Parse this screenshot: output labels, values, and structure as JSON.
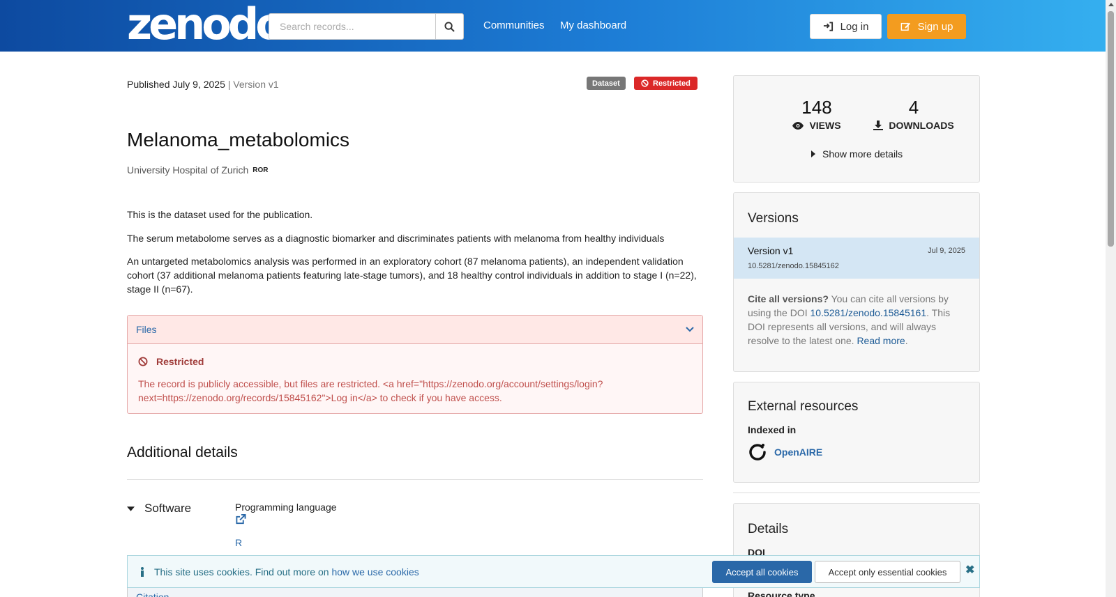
{
  "header": {
    "logo": "zenodo",
    "search_placeholder": "Search records...",
    "nav": [
      "Communities",
      "My dashboard"
    ],
    "login_label": "Log in",
    "signup_label": "Sign up"
  },
  "record": {
    "published": "Published July 9, 2025",
    "version_sep": "| Version v1",
    "badge_type": "Dataset",
    "badge_access": "Restricted",
    "title": "Melanoma_metabolomics",
    "affiliation": "University Hospital of Zurich",
    "ror_label": "ROR",
    "description": [
      "This is the dataset used for the publication.",
      "The serum metabolome serves as a diagnostic biomarker and discriminates patients with melanoma from healthy individuals",
      "An untargeted metabolomics analysis was performed in an exploratory cohort (87 melanoma patients), an independent validation cohort (37 additional melanoma patients featuring late-stage tumors), and 18 healthy control individuals in addition to stage I (n=22), stage II (n=67)."
    ]
  },
  "files": {
    "header": "Files",
    "restricted_title": "Restricted",
    "restricted_message": "The record is publicly accessible, but files are restricted. <a href=\"https://zenodo.org/account/settings/login?next=https://zenodo.org/records/15845162\">Log in</a> to check if you have access."
  },
  "additional": {
    "title": "Additional details",
    "software_label": "Software",
    "programming_language_label": "Programming language",
    "language_value": "R"
  },
  "citation_label": "Citation",
  "stats": {
    "views": "148",
    "views_label": "VIEWS",
    "downloads": "4",
    "downloads_label": "DOWNLOADS",
    "show_more": "Show more details"
  },
  "versions": {
    "title": "Versions",
    "current_label": "Version v1",
    "current_date": "Jul 9, 2025",
    "current_doi": "10.5281/zenodo.15845162",
    "cite_bold": "Cite all versions?",
    "cite_text_1": " You can cite all versions by using the DOI ",
    "concept_doi": "10.5281/zenodo.15845161",
    "cite_text_2": ". This DOI represents all versions, and will always resolve to the latest one. ",
    "read_more": "Read more",
    "period": "."
  },
  "external": {
    "title": "External resources",
    "indexed_in": "Indexed in",
    "openaire": "OpenAIRE"
  },
  "details": {
    "title": "Details",
    "doi_label": "DOI",
    "resource_type_label": "Resource type"
  },
  "cookie": {
    "text": "This site uses cookies. Find out more on ",
    "link": "how we use cookies",
    "accept_all": "Accept all cookies",
    "accept_essential": "Accept only essential cookies"
  }
}
